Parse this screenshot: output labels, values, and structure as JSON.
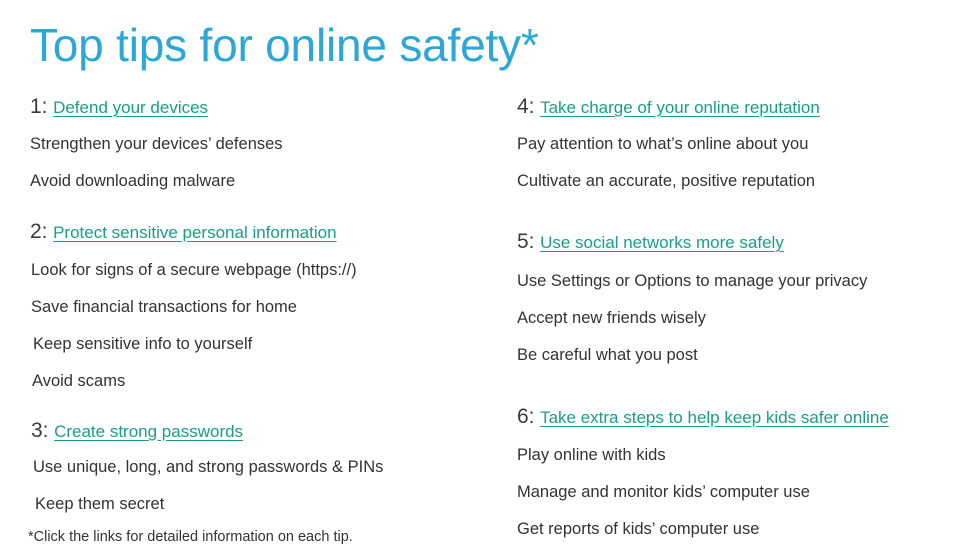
{
  "slide": {
    "title": "Top tips for online safety*",
    "background_color": "#ffffff",
    "title_color": "#2ca8d8",
    "link_color": "#18a086",
    "text_color": "#333333",
    "number_color": "#3b3b3b",
    "footnote": "*Click the links for detailed information on each tip."
  },
  "left_column": [
    {
      "number": "1:",
      "link": "Defend your devices",
      "bullets": [
        "Strengthen your devices’ defenses",
        "Avoid downloading malware"
      ]
    },
    {
      "number": "2:",
      "link": "Protect sensitive personal information",
      "bullets": [
        "Look for signs of a secure webpage (https://)",
        "Save financial transactions for home",
        "Keep sensitive info to yourself",
        "Avoid scams"
      ]
    },
    {
      "number": "3:",
      "link": "Create strong passwords",
      "bullets": [
        "Use unique, long, and strong passwords & PINs",
        "Keep them secret"
      ]
    }
  ],
  "right_column": [
    {
      "number": "4:",
      "link": "Take charge of your online reputation",
      "bullets": [
        "Pay attention to what’s online about you",
        "Cultivate an accurate, positive reputation"
      ]
    },
    {
      "number": "5:",
      "link": "Use social networks more safely",
      "bullets": [
        "Use Settings or Options to manage your privacy",
        "Accept new friends wisely",
        "Be careful what you post"
      ]
    },
    {
      "number": "6:",
      "link": "Take extra steps to help keep kids safer online",
      "bullets": [
        "Play online with kids",
        "Manage and monitor kids’ computer use",
        "Get reports of kids’ computer use"
      ]
    }
  ]
}
